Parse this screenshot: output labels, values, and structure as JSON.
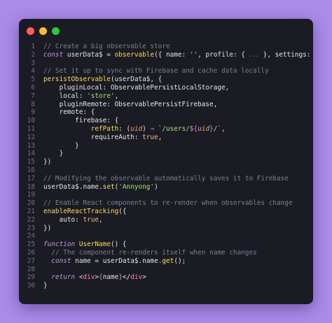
{
  "window": {
    "close_color": "#ff5f56",
    "minimize_color": "#ffbd2e",
    "maximize_color": "#27c93f"
  },
  "editor": {
    "lines": [
      {
        "num": "1",
        "tokens": [
          [
            "c",
            "// Create a big observable store"
          ]
        ]
      },
      {
        "num": "2",
        "tokens": [
          [
            "k",
            "const"
          ],
          [
            "n",
            " userData$ "
          ],
          [
            "p",
            "="
          ],
          [
            "n",
            " "
          ],
          [
            "f",
            "observable"
          ],
          [
            "p",
            "({ name: "
          ],
          [
            "s",
            "''"
          ],
          [
            "p",
            ", profile: { "
          ],
          [
            "e",
            "..."
          ],
          [
            "p",
            " }, settings: { "
          ],
          [
            "e",
            "..."
          ],
          [
            "p",
            " }})"
          ]
        ]
      },
      {
        "num": "3",
        "tokens": []
      },
      {
        "num": "4",
        "tokens": [
          [
            "c",
            "// Set it up to sync with Firebase and cache data locally"
          ]
        ]
      },
      {
        "num": "5",
        "tokens": [
          [
            "f",
            "persistObservable"
          ],
          [
            "p",
            "(userData$, {"
          ]
        ]
      },
      {
        "num": "6",
        "tokens": [
          [
            "n",
            "    pluginLocal: ObservablePersistLocalStorage,"
          ]
        ]
      },
      {
        "num": "7",
        "tokens": [
          [
            "n",
            "    local: "
          ],
          [
            "s",
            "'store'"
          ],
          [
            "p",
            ","
          ]
        ]
      },
      {
        "num": "8",
        "tokens": [
          [
            "n",
            "    pluginRemote: ObservablePersistFirebase,"
          ]
        ]
      },
      {
        "num": "9",
        "tokens": [
          [
            "n",
            "    remote: {"
          ]
        ]
      },
      {
        "num": "10",
        "tokens": [
          [
            "n",
            "        firebase: {"
          ]
        ]
      },
      {
        "num": "11",
        "tokens": [
          [
            "n",
            "            "
          ],
          [
            "f",
            "refPath"
          ],
          [
            "p",
            ": ("
          ],
          [
            "i",
            "uid"
          ],
          [
            "p",
            ") "
          ],
          [
            "k",
            "⇒"
          ],
          [
            "p",
            " "
          ],
          [
            "s",
            "`/users/"
          ],
          [
            "b",
            "${"
          ],
          [
            "i",
            "uid"
          ],
          [
            "b",
            "}"
          ],
          [
            "s",
            "/`"
          ],
          [
            "p",
            ","
          ]
        ]
      },
      {
        "num": "12",
        "tokens": [
          [
            "n",
            "            requireAuth: "
          ],
          [
            "v",
            "true"
          ],
          [
            "p",
            ","
          ]
        ]
      },
      {
        "num": "13",
        "tokens": [
          [
            "n",
            "        }"
          ]
        ]
      },
      {
        "num": "14",
        "tokens": [
          [
            "n",
            "    }"
          ]
        ]
      },
      {
        "num": "15",
        "tokens": [
          [
            "p",
            "})"
          ]
        ]
      },
      {
        "num": "16",
        "tokens": []
      },
      {
        "num": "17",
        "tokens": [
          [
            "c",
            "// Modifying the observable automatically saves it to Firebase"
          ]
        ]
      },
      {
        "num": "18",
        "tokens": [
          [
            "n",
            "userData$.name."
          ],
          [
            "f",
            "set"
          ],
          [
            "p",
            "("
          ],
          [
            "s",
            "'Annyong'"
          ],
          [
            "p",
            ")"
          ]
        ]
      },
      {
        "num": "19",
        "tokens": []
      },
      {
        "num": "20",
        "tokens": [
          [
            "c",
            "// Enable React components to re-render when observables change"
          ]
        ]
      },
      {
        "num": "21",
        "tokens": [
          [
            "f",
            "enableReactTracking"
          ],
          [
            "p",
            "({"
          ]
        ]
      },
      {
        "num": "22",
        "tokens": [
          [
            "n",
            "    auto: "
          ],
          [
            "v",
            "true"
          ],
          [
            "p",
            ","
          ]
        ]
      },
      {
        "num": "23",
        "tokens": [
          [
            "p",
            "})"
          ]
        ]
      },
      {
        "num": "24",
        "tokens": []
      },
      {
        "num": "25",
        "tokens": [
          [
            "k",
            "function"
          ],
          [
            "n",
            " "
          ],
          [
            "f",
            "UserName"
          ],
          [
            "p",
            "() {"
          ]
        ]
      },
      {
        "num": "26",
        "tokens": [
          [
            "n",
            "  "
          ],
          [
            "c",
            "// The component re-renders itself when name changes"
          ]
        ]
      },
      {
        "num": "27",
        "tokens": [
          [
            "n",
            "  "
          ],
          [
            "k",
            "const"
          ],
          [
            "n",
            " name "
          ],
          [
            "p",
            "="
          ],
          [
            "n",
            " userData$.name."
          ],
          [
            "f",
            "get"
          ],
          [
            "p",
            "();"
          ]
        ]
      },
      {
        "num": "28",
        "tokens": []
      },
      {
        "num": "29",
        "tokens": [
          [
            "n",
            "  "
          ],
          [
            "k",
            "return"
          ],
          [
            "n",
            " "
          ],
          [
            "p",
            "<"
          ],
          [
            "t",
            "div"
          ],
          [
            "p",
            ">"
          ],
          [
            "b",
            "{"
          ],
          [
            "n",
            "name"
          ],
          [
            "b",
            "}"
          ],
          [
            "p",
            "</"
          ],
          [
            "t",
            "div"
          ],
          [
            "p",
            ">"
          ]
        ]
      },
      {
        "num": "30",
        "tokens": [
          [
            "p",
            "}"
          ]
        ]
      }
    ]
  }
}
